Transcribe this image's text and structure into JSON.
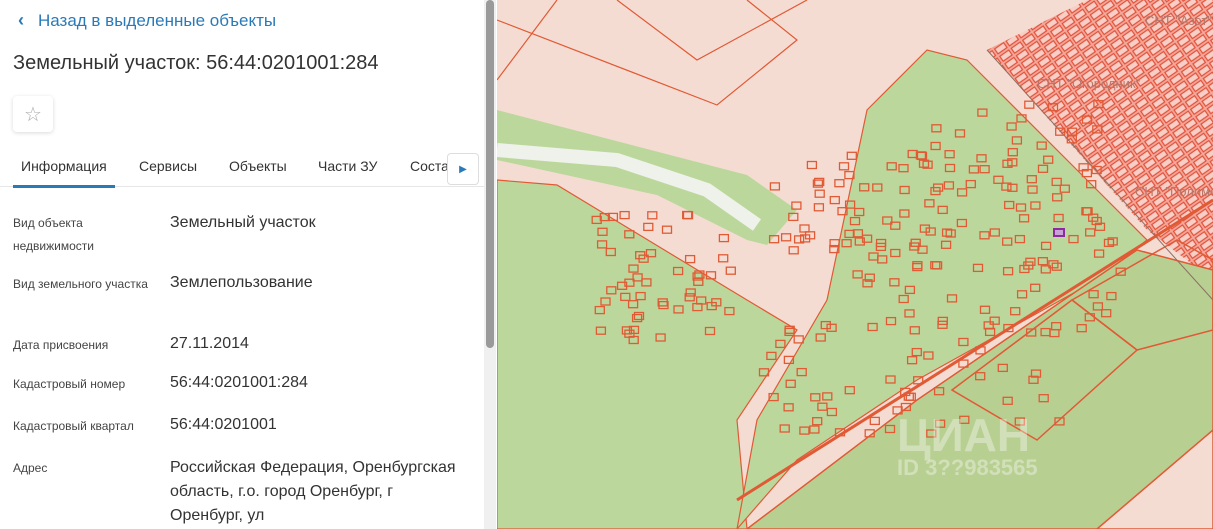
{
  "panel": {
    "back_label": "Назад в выделенные объекты",
    "title": "Земельный участок: 56:44:0201001:284",
    "tabs": [
      {
        "label": "Информация",
        "active": true
      },
      {
        "label": "Сервисы"
      },
      {
        "label": "Объекты"
      },
      {
        "label": "Части ЗУ"
      },
      {
        "label": "Соста"
      }
    ],
    "fields": [
      {
        "label": "Вид объекта недвижимости",
        "value": "Земельный участок"
      },
      {
        "label": "Вид земельного участка",
        "value": "Землепользование"
      },
      {
        "label": "Дата присвоения",
        "value": "27.11.2014"
      },
      {
        "label": "Кадастровый номер",
        "value": "56:44:0201001:284"
      },
      {
        "label": "Кадастровый квартал",
        "value": "56:44:0201001"
      },
      {
        "label": "Адрес",
        "value": "Российская Федерация, Оренбургская область, г.о. город Оренбург, г Оренбург, ул"
      }
    ]
  },
  "map": {
    "labels": [
      "СНТ \"Азот\"",
      "СНТ \"Огородник\"",
      "СНТ \"Полимер\""
    ],
    "watermark": "ЦИАН",
    "watermark_id": "ID 3??983565",
    "colors": {
      "background": "#f5dcd3",
      "green": "#bcd79c",
      "line": "#e05a35",
      "selected": "#8b2a9a"
    }
  }
}
